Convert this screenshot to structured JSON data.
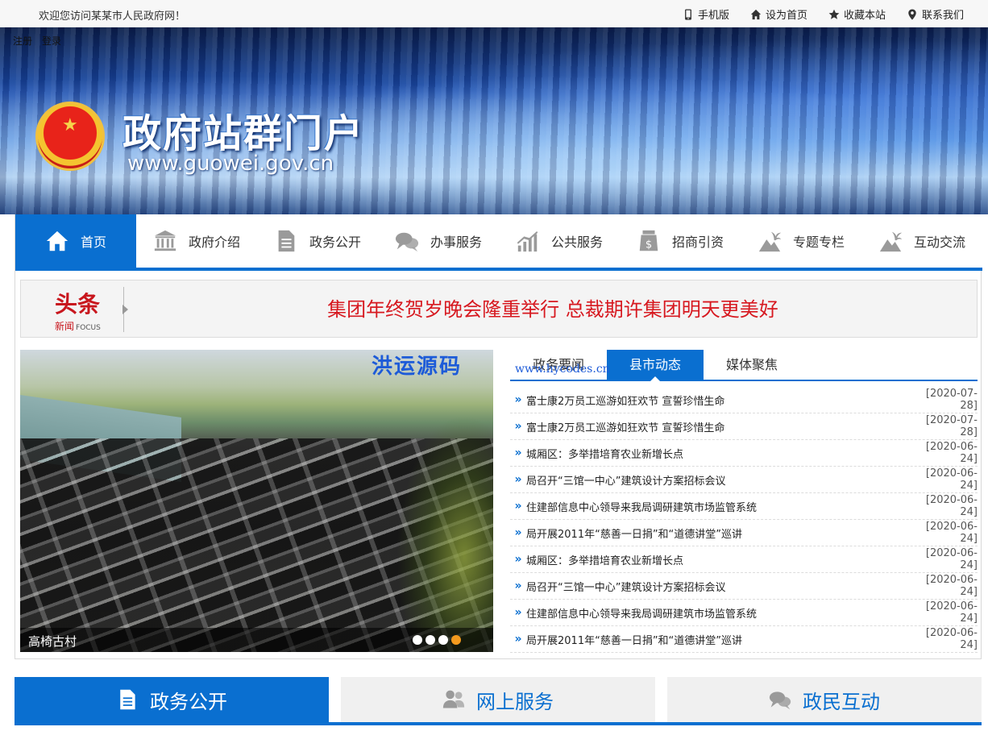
{
  "topbar": {
    "welcome": "欢迎您访问某某市人民政府网！",
    "links": [
      {
        "label": "手机版",
        "icon": "mobile-icon"
      },
      {
        "label": "设为首页",
        "icon": "home-icon"
      },
      {
        "label": "收藏本站",
        "icon": "star-icon"
      },
      {
        "label": "联系我们",
        "icon": "location-icon"
      }
    ]
  },
  "banner": {
    "login": "注册",
    "register": "登录",
    "title": "政府站群门户",
    "url": "www.guowei.gov.cn"
  },
  "nav": {
    "items": [
      {
        "label": "首页",
        "icon": "home-icon"
      },
      {
        "label": "政府介绍",
        "icon": "building-icon"
      },
      {
        "label": "政务公开",
        "icon": "document-icon"
      },
      {
        "label": "办事服务",
        "icon": "chat-icon"
      },
      {
        "label": "公共服务",
        "icon": "chart-icon"
      },
      {
        "label": "招商引资",
        "icon": "money-icon"
      },
      {
        "label": "专题专栏",
        "icon": "palm-icon"
      },
      {
        "label": "互动交流",
        "icon": "palm-icon"
      }
    ]
  },
  "headline": {
    "logo_big": "头条",
    "logo_small": "新闻",
    "logo_focus": "FOCUS",
    "text": "集团年终贺岁晚会隆重举行 总裁期许集团明天更美好"
  },
  "slider": {
    "watermark": "洪运源码",
    "caption": "高椅古村",
    "dots": 4,
    "active_dot": 3
  },
  "news": {
    "mark": "www.hycodes.cn",
    "tabs": [
      "政务要闻",
      "县市动态",
      "媒体聚焦"
    ],
    "active_tab": 1,
    "items": [
      {
        "title": "富士康2万员工巡游如狂欢节 宣誓珍惜生命",
        "date": "[2020-07-28]"
      },
      {
        "title": "富士康2万员工巡游如狂欢节 宣誓珍惜生命",
        "date": "[2020-07-28]"
      },
      {
        "title": "城厢区：多举措培育农业新增长点",
        "date": "[2020-06-24]"
      },
      {
        "title": "局召开“三馆一中心”建筑设计方案招标会议",
        "date": "[2020-06-24]"
      },
      {
        "title": "住建部信息中心领导来我局调研建筑市场监管系统",
        "date": "[2020-06-24]"
      },
      {
        "title": "局开展2011年“慈善一日捐”和“道德讲堂”巡讲",
        "date": "[2020-06-24]"
      },
      {
        "title": "城厢区：多举措培育农业新增长点",
        "date": "[2020-06-24]"
      },
      {
        "title": "局召开“三馆一中心”建筑设计方案招标会议",
        "date": "[2020-06-24]"
      },
      {
        "title": "住建部信息中心领导来我局调研建筑市场监管系统",
        "date": "[2020-06-24]"
      },
      {
        "title": "局开展2011年“慈善一日捐”和“道德讲堂”巡讲",
        "date": "[2020-06-24]"
      }
    ]
  },
  "bottom_tabs": [
    {
      "label": "政务公开",
      "icon": "document-icon"
    },
    {
      "label": "网上服务",
      "icon": "users-icon"
    },
    {
      "label": "政民互动",
      "icon": "chat-icon"
    }
  ],
  "colors": {
    "primary": "#0a6fd0",
    "headline_red": "#d71920",
    "active_dot": "#f39a1e"
  }
}
